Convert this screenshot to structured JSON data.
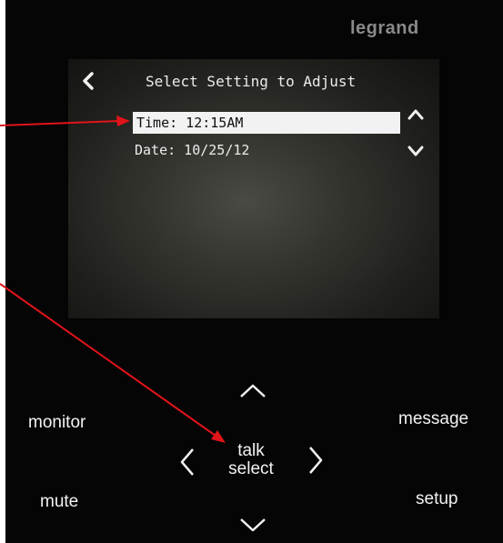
{
  "brand": {
    "name": "legrand"
  },
  "screen": {
    "title": "Select Setting to Adjust",
    "items": [
      {
        "label": "Time: 12:15AM",
        "selected": true
      },
      {
        "label": "Date: 10/25/12",
        "selected": false
      }
    ]
  },
  "buttons": {
    "monitor": "monitor",
    "message": "message",
    "mute": "mute",
    "setup": "setup",
    "talk": "talk",
    "select": "select"
  },
  "icons": {
    "back": "chevron-left-icon",
    "scroll_up": "chevron-up-icon",
    "scroll_down": "chevron-down-icon"
  },
  "colors": {
    "device_body": "#050505",
    "screen_text": "#ececec",
    "highlight": "#f2f2f2",
    "brand_gray": "#8a8a8a",
    "annotation_arrow": "#e0141a"
  }
}
